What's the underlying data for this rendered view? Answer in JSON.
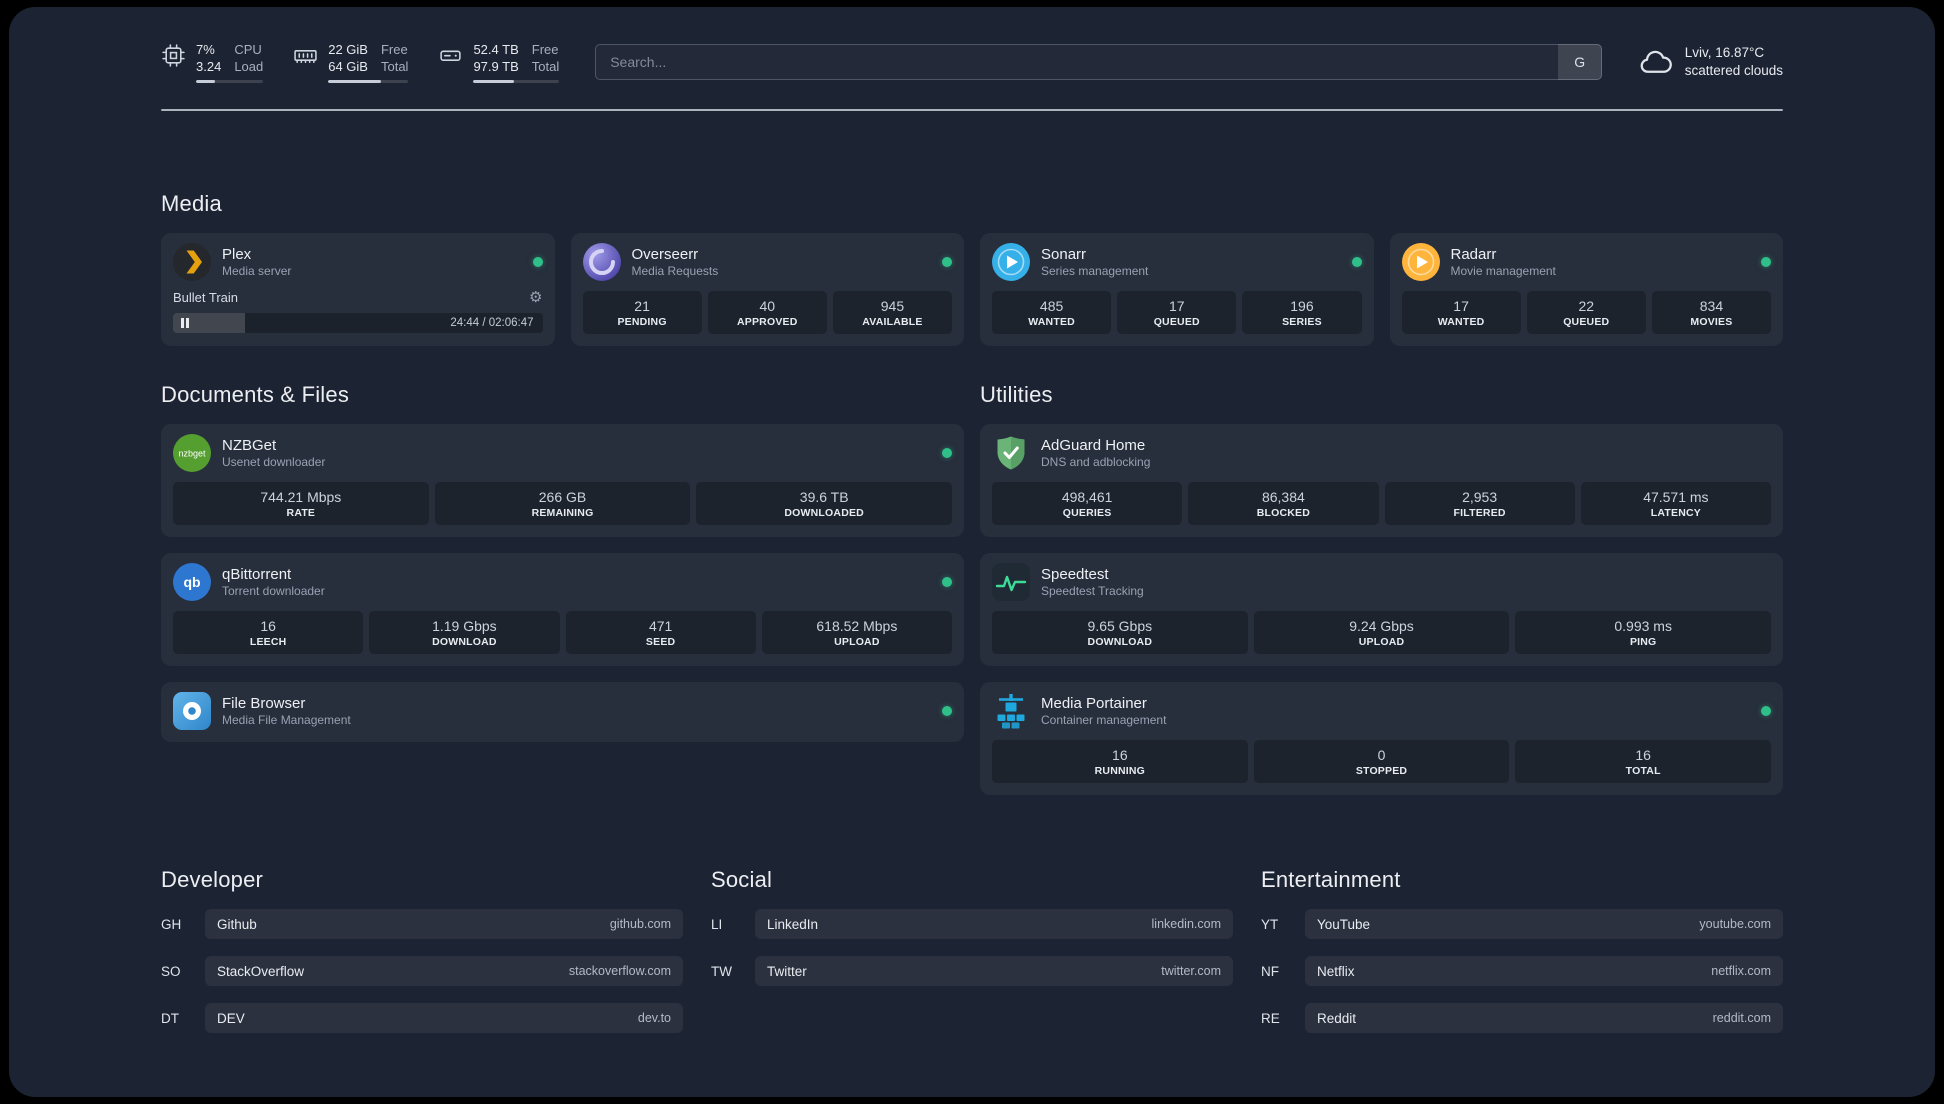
{
  "colors": {
    "background": "#1c2332",
    "status_online": "#2fc08a",
    "divider": "#c6ccd6"
  },
  "icons": {
    "gear": "⚙"
  },
  "header": {
    "resources": [
      {
        "name": "cpu",
        "top_left": "7%",
        "bottom_left": "3.24",
        "top_right": "CPU",
        "bottom_right": "Load",
        "bar_style": "width:28%"
      },
      {
        "name": "memory",
        "top_left": "22 GiB",
        "bottom_left": "64 GiB",
        "top_right": "Free",
        "bottom_right": "Total",
        "bar_style": "width:66%"
      },
      {
        "name": "disk",
        "top_left": "52.4 TB",
        "bottom_left": "97.9 TB",
        "top_right": "Free",
        "bottom_right": "Total",
        "bar_style": "width:47%"
      }
    ],
    "search": {
      "placeholder": "Search...",
      "provider_label": "G"
    },
    "weather": {
      "location": "Lviv, 16.87°C",
      "condition": "scattered clouds"
    }
  },
  "groups": {
    "media": {
      "title": "Media",
      "cards": [
        {
          "name": "Plex",
          "desc": "Media server",
          "online": true,
          "player": {
            "track": "Bullet Train",
            "time": "24:44 / 02:06:47",
            "progress_style": "width:19.5%"
          }
        },
        {
          "name": "Overseerr",
          "desc": "Media Requests",
          "online": true,
          "stats": [
            {
              "value": "21",
              "label": "PENDING"
            },
            {
              "value": "40",
              "label": "APPROVED"
            },
            {
              "value": "945",
              "label": "AVAILABLE"
            }
          ]
        },
        {
          "name": "Sonarr",
          "desc": "Series management",
          "online": true,
          "stats": [
            {
              "value": "485",
              "label": "WANTED"
            },
            {
              "value": "17",
              "label": "QUEUED"
            },
            {
              "value": "196",
              "label": "SERIES"
            }
          ]
        },
        {
          "name": "Radarr",
          "desc": "Movie management",
          "online": true,
          "stats": [
            {
              "value": "17",
              "label": "WANTED"
            },
            {
              "value": "22",
              "label": "QUEUED"
            },
            {
              "value": "834",
              "label": "MOVIES"
            }
          ]
        }
      ]
    },
    "files": {
      "title": "Documents & Files",
      "cards": [
        {
          "name": "NZBGet",
          "desc": "Usenet downloader",
          "online": true,
          "stats": [
            {
              "value": "744.21 Mbps",
              "label": "RATE"
            },
            {
              "value": "266 GB",
              "label": "REMAINING"
            },
            {
              "value": "39.6 TB",
              "label": "DOWNLOADED"
            }
          ]
        },
        {
          "name": "qBittorrent",
          "desc": "Torrent downloader",
          "online": true,
          "stats": [
            {
              "value": "16",
              "label": "LEECH"
            },
            {
              "value": "1.19 Gbps",
              "label": "DOWNLOAD"
            },
            {
              "value": "471",
              "label": "SEED"
            },
            {
              "value": "618.52 Mbps",
              "label": "UPLOAD"
            }
          ]
        },
        {
          "name": "File Browser",
          "desc": "Media File Management",
          "online": true,
          "stats": []
        }
      ]
    },
    "utilities": {
      "title": "Utilities",
      "cards": [
        {
          "name": "AdGuard Home",
          "desc": "DNS and adblocking",
          "online": false,
          "stats": [
            {
              "value": "498,461",
              "label": "QUERIES"
            },
            {
              "value": "86,384",
              "label": "BLOCKED"
            },
            {
              "value": "2,953",
              "label": "FILTERED"
            },
            {
              "value": "47.571 ms",
              "label": "LATENCY"
            }
          ]
        },
        {
          "name": "Speedtest",
          "desc": "Speedtest Tracking",
          "online": false,
          "stats": [
            {
              "value": "9.65 Gbps",
              "label": "DOWNLOAD"
            },
            {
              "value": "9.24 Gbps",
              "label": "UPLOAD"
            },
            {
              "value": "0.993 ms",
              "label": "PING"
            }
          ]
        },
        {
          "name": "Media Portainer",
          "desc": "Container management",
          "online": true,
          "stats": [
            {
              "value": "16",
              "label": "RUNNING"
            },
            {
              "value": "0",
              "label": "STOPPED"
            },
            {
              "value": "16",
              "label": "TOTAL"
            }
          ]
        }
      ]
    }
  },
  "bookmarks": {
    "groups": [
      {
        "title": "Developer",
        "items": [
          {
            "abbr": "GH",
            "name": "Github",
            "url": "github.com"
          },
          {
            "abbr": "SO",
            "name": "StackOverflow",
            "url": "stackoverflow.com"
          },
          {
            "abbr": "DT",
            "name": "DEV",
            "url": "dev.to"
          }
        ]
      },
      {
        "title": "Social",
        "items": [
          {
            "abbr": "LI",
            "name": "LinkedIn",
            "url": "linkedin.com"
          },
          {
            "abbr": "TW",
            "name": "Twitter",
            "url": "twitter.com"
          }
        ]
      },
      {
        "title": "Entertainment",
        "items": [
          {
            "abbr": "YT",
            "name": "YouTube",
            "url": "youtube.com"
          },
          {
            "abbr": "NF",
            "name": "Netflix",
            "url": "netflix.com"
          },
          {
            "abbr": "RE",
            "name": "Reddit",
            "url": "reddit.com"
          }
        ]
      }
    ]
  }
}
